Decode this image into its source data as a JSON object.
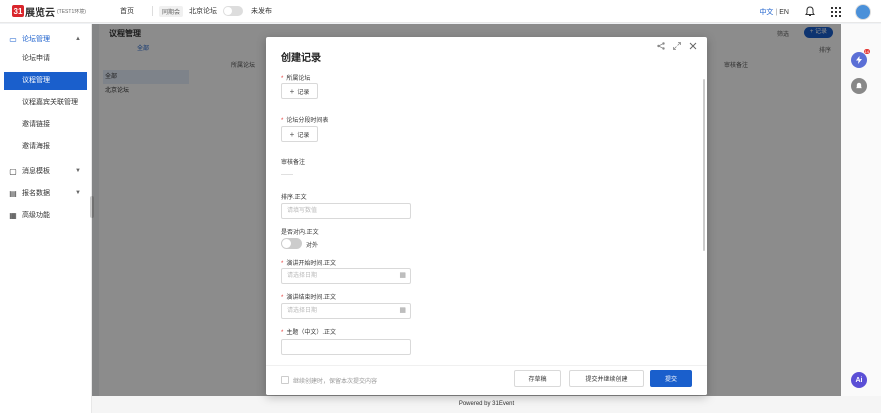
{
  "brand": {
    "mark": "31",
    "name": "展览云",
    "suffix": "(TEST1环境)"
  },
  "topnav": {
    "home": "首页",
    "tag": "同期会",
    "forum": "北京论坛",
    "status": "未发布"
  },
  "lang": {
    "zh": "中文",
    "sep": "|",
    "en": "EN"
  },
  "sidebar": {
    "forum_group": "论坛管理",
    "items": [
      "论坛申请",
      "议程管理",
      "议程嘉宾关联管理",
      "邀请链接",
      "邀请海报"
    ],
    "other_groups": [
      "消息模板",
      "报名数据",
      "高级功能"
    ]
  },
  "bg": {
    "title": "议程管理",
    "tab": "全部",
    "left_items": [
      "全部",
      "北京论坛"
    ],
    "col_forum": "所属论坛",
    "col_review": "审核备注",
    "add_btn": "+ 记录",
    "filter": "筛选",
    "sort": "排序"
  },
  "modal": {
    "title": "创建记录",
    "forum_label": "所属论坛",
    "segment_label": "论坛分段时间表",
    "add_record": "记录",
    "review_label": "审核备注",
    "review_value": "——",
    "order_label": "排序.正文",
    "order_placeholder": "请填写数值",
    "external_label": "是否对内.正文",
    "external_text": "对外",
    "start_label": "演讲开始时间.正文",
    "start_placeholder": "请选择日期",
    "end_label": "演讲结束时间.正文",
    "end_placeholder": "请选择日期",
    "topic_label": "主题（中文）.正文",
    "keep_content": "继续创建时，保留本次提交内容",
    "draft_btn": "存草稿",
    "continue_btn": "提交并继续创建",
    "submit_btn": "提交"
  },
  "rail": {
    "badge": "14",
    "ai": "Ai"
  },
  "footer": "Powered by 31Event",
  "colors": {
    "primary": "#1a5fcc",
    "brand_red": "#d9262c",
    "required": "#e53935"
  }
}
